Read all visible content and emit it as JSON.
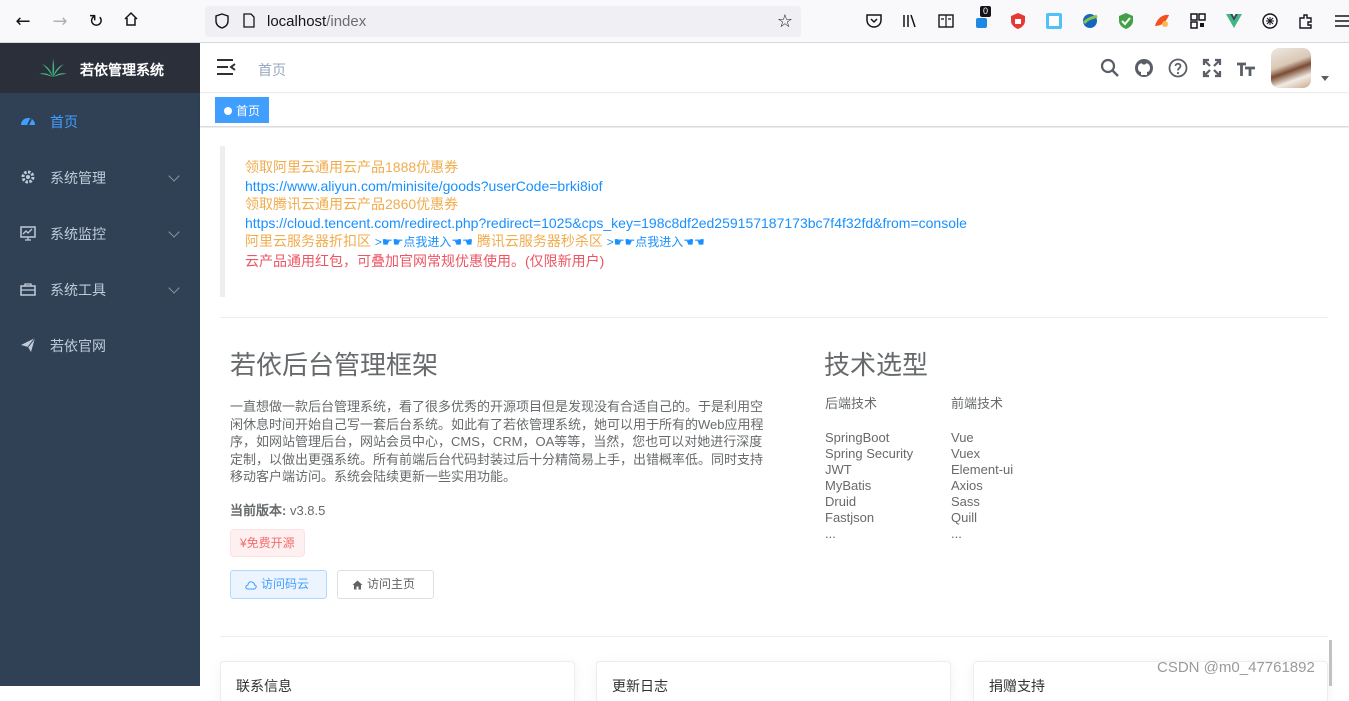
{
  "browser": {
    "url_host": "localhost",
    "url_path": "/index",
    "extensions": [
      "pocket-icon",
      "library-icon",
      "reader-view-icon",
      "notification-extension-icon",
      "shield-extension-icon",
      "translate-extension-icon",
      "globe-extension-icon",
      "green-shield-icon",
      "fox-extension-icon",
      "qr-code-icon",
      "vue-devtools-icon",
      "ai-extension-icon",
      "extensions-icon",
      "menu-icon"
    ],
    "badge_count": "0"
  },
  "sidebar": {
    "logo_title": "若依管理系统",
    "items": [
      {
        "label": "首页",
        "icon": "dashboard-icon",
        "active": true
      },
      {
        "label": "系统管理",
        "icon": "gear-icon",
        "active": false,
        "has_submenu": true
      },
      {
        "label": "系统监控",
        "icon": "monitor-icon",
        "active": false,
        "has_submenu": true
      },
      {
        "label": "系统工具",
        "icon": "toolbox-icon",
        "active": false,
        "has_submenu": true
      },
      {
        "label": "若依官网",
        "icon": "paper-plane-icon",
        "active": false
      }
    ]
  },
  "navbar": {
    "breadcrumb": "首页",
    "icons": [
      "search-icon",
      "github-icon",
      "question-icon",
      "fullscreen-icon",
      "font-size-icon"
    ]
  },
  "tags": [
    {
      "label": "首页",
      "active": true
    }
  ],
  "notice": {
    "line1": "领取阿里云通用云产品1888优惠券",
    "line2": "https://www.aliyun.com/minisite/goods?userCode=brki8iof",
    "line3": "领取腾讯云通用云产品2860优惠券",
    "line4": "https://cloud.tencent.com/redirect.php?redirect=1025&cps_key=198c8df2ed259157187173bc7f4f32fd&from=console",
    "line5_a": "阿里云服务器折扣区",
    "line5_b": ">☛☛点我进入☚☚",
    "line5_c": "腾讯云服务器秒杀区",
    "line5_d": ">☛☛点我进入☚☚",
    "line6": "云产品通用红包，可叠加官网常规优惠使用。(仅限新用户)"
  },
  "intro": {
    "title": "若依后台管理框架",
    "description": "一直想做一款后台管理系统，看了很多优秀的开源项目但是发现没有合适自己的。于是利用空闲休息时间开始自己写一套后台系统。如此有了若依管理系统，她可以用于所有的Web应用程序，如网站管理后台，网站会员中心，CMS，CRM，OA等等，当然，您也可以对她进行深度定制，以做出更强系统。所有前端后台代码封装过后十分精简易上手，出错概率低。同时支持移动客户端访问。系统会陆续更新一些实用功能。",
    "version_label": "当前版本:",
    "version_value": "v3.8.5",
    "free_tag": "¥免费开源",
    "btn_gitee": "访问码云",
    "btn_home": "访问主页"
  },
  "tech": {
    "title": "技术选型",
    "backend_head": "后端技术",
    "frontend_head": "前端技术",
    "backend": [
      "SpringBoot",
      "Spring Security",
      "JWT",
      "MyBatis",
      "Druid",
      "Fastjson",
      "..."
    ],
    "frontend": [
      "Vue",
      "Vuex",
      "Element-ui",
      "Axios",
      "Sass",
      "Quill",
      "..."
    ]
  },
  "cards": [
    {
      "title": "联系信息"
    },
    {
      "title": "更新日志"
    },
    {
      "title": "捐赠支持"
    }
  ],
  "watermark": "CSDN @m0_47761892"
}
